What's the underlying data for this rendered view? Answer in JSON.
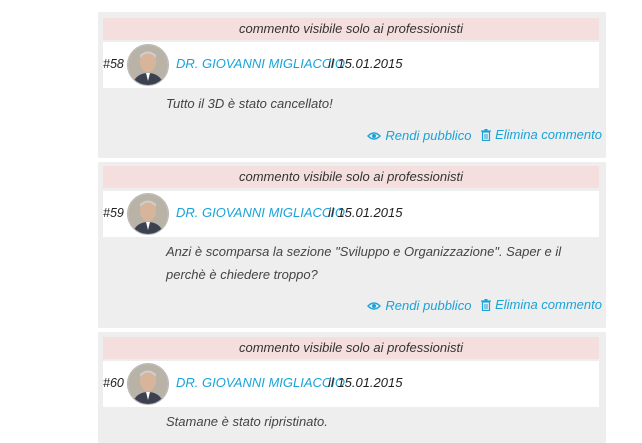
{
  "labels": {
    "visibility_banner": "commento visibile solo ai professionisti",
    "make_public": "Rendi pubblico",
    "delete_comment": "Elimina commento"
  },
  "comments": [
    {
      "number": "#58",
      "author": "DR. GIOVANNI MIGLIACCIO",
      "date": "il 15.01.2015",
      "text": "Tutto il 3D è stato cancellato!"
    },
    {
      "number": "#59",
      "author": "DR. GIOVANNI MIGLIACCIO",
      "date": "il 15.01.2015",
      "text": "Anzi è scomparsa la sezione \"Sviluppo e Organizzazione\". Saper e il perchè è chiedere troppo?"
    },
    {
      "number": "#60",
      "author": "DR. GIOVANNI MIGLIACCIO",
      "date": "il 15.01.2015",
      "text": "Stamane è stato ripristinato."
    }
  ],
  "colors": {
    "link": "#1aa3d9",
    "banner_bg": "#f4dede",
    "card_bg": "#eeeeee"
  },
  "icons": {
    "make_public": "eye-icon",
    "delete": "trash-icon",
    "avatar": "user-photo"
  }
}
